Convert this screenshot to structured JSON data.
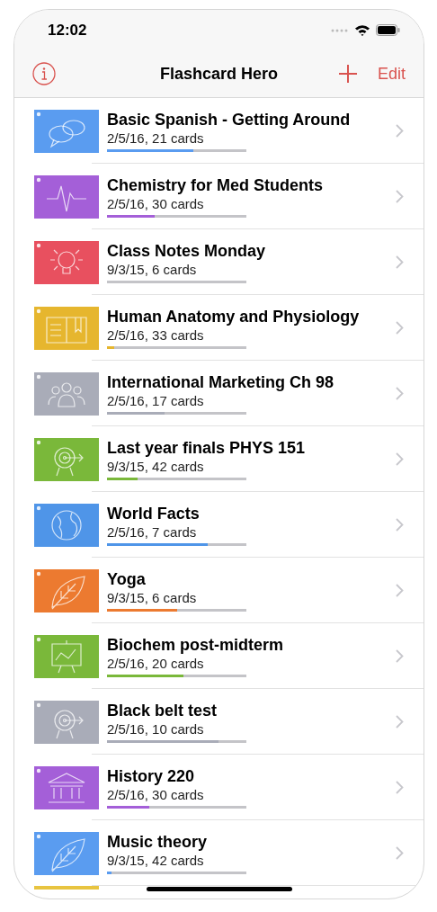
{
  "status_bar": {
    "time": "12:02"
  },
  "nav_bar": {
    "title": "Flashcard Hero",
    "edit": "Edit"
  },
  "decks": [
    {
      "title": "Basic Spanish - Getting Around",
      "subtitle": "2/5/16, 21 cards",
      "kind": "chat",
      "color": "#5a9cf0",
      "level": 0.62
    },
    {
      "title": "Chemistry for Med Students",
      "subtitle": "2/5/16, 30 cards",
      "kind": "pulse",
      "color": "#a45fd8",
      "level": 0.34
    },
    {
      "title": "Class Notes Monday",
      "subtitle": "9/3/15, 6 cards",
      "kind": "bulb",
      "color": "#e8505f",
      "level": 0
    },
    {
      "title": "Human Anatomy and Physiology",
      "subtitle": "2/5/16, 33 cards",
      "kind": "book",
      "color": "#e6b62e",
      "level": 0.05
    },
    {
      "title": "International Marketing Ch 98",
      "subtitle": "2/5/16, 17 cards",
      "kind": "people",
      "color": "#a9acb8",
      "level": 0.41
    },
    {
      "title": "Last year finals PHYS 151",
      "subtitle": "9/3/15, 42 cards",
      "kind": "target",
      "color": "#7ab83a",
      "level": 0.22
    },
    {
      "title": "World Facts",
      "subtitle": "2/5/16, 7 cards",
      "kind": "globe",
      "color": "#4f95e8",
      "level": 0.72
    },
    {
      "title": "Yoga",
      "subtitle": "9/3/15, 6 cards",
      "kind": "leaf",
      "color": "#ec7a30",
      "level": 0.5
    },
    {
      "title": "Biochem post-midterm",
      "subtitle": "2/5/16, 20 cards",
      "kind": "chart",
      "color": "#7ab83a",
      "level": 0.55
    },
    {
      "title": "Black belt test",
      "subtitle": "2/5/16, 10 cards",
      "kind": "target",
      "color": "#a9acb8",
      "level": 0.8
    },
    {
      "title": "History 220",
      "subtitle": "2/5/16, 30 cards",
      "kind": "bank",
      "color": "#a45fd8",
      "level": 0.3
    },
    {
      "title": "Music theory",
      "subtitle": "9/3/15, 42 cards",
      "kind": "leaf",
      "color": "#5a9cf0",
      "level": 0.03
    }
  ],
  "peek_row": {
    "color": "#e8c440"
  }
}
